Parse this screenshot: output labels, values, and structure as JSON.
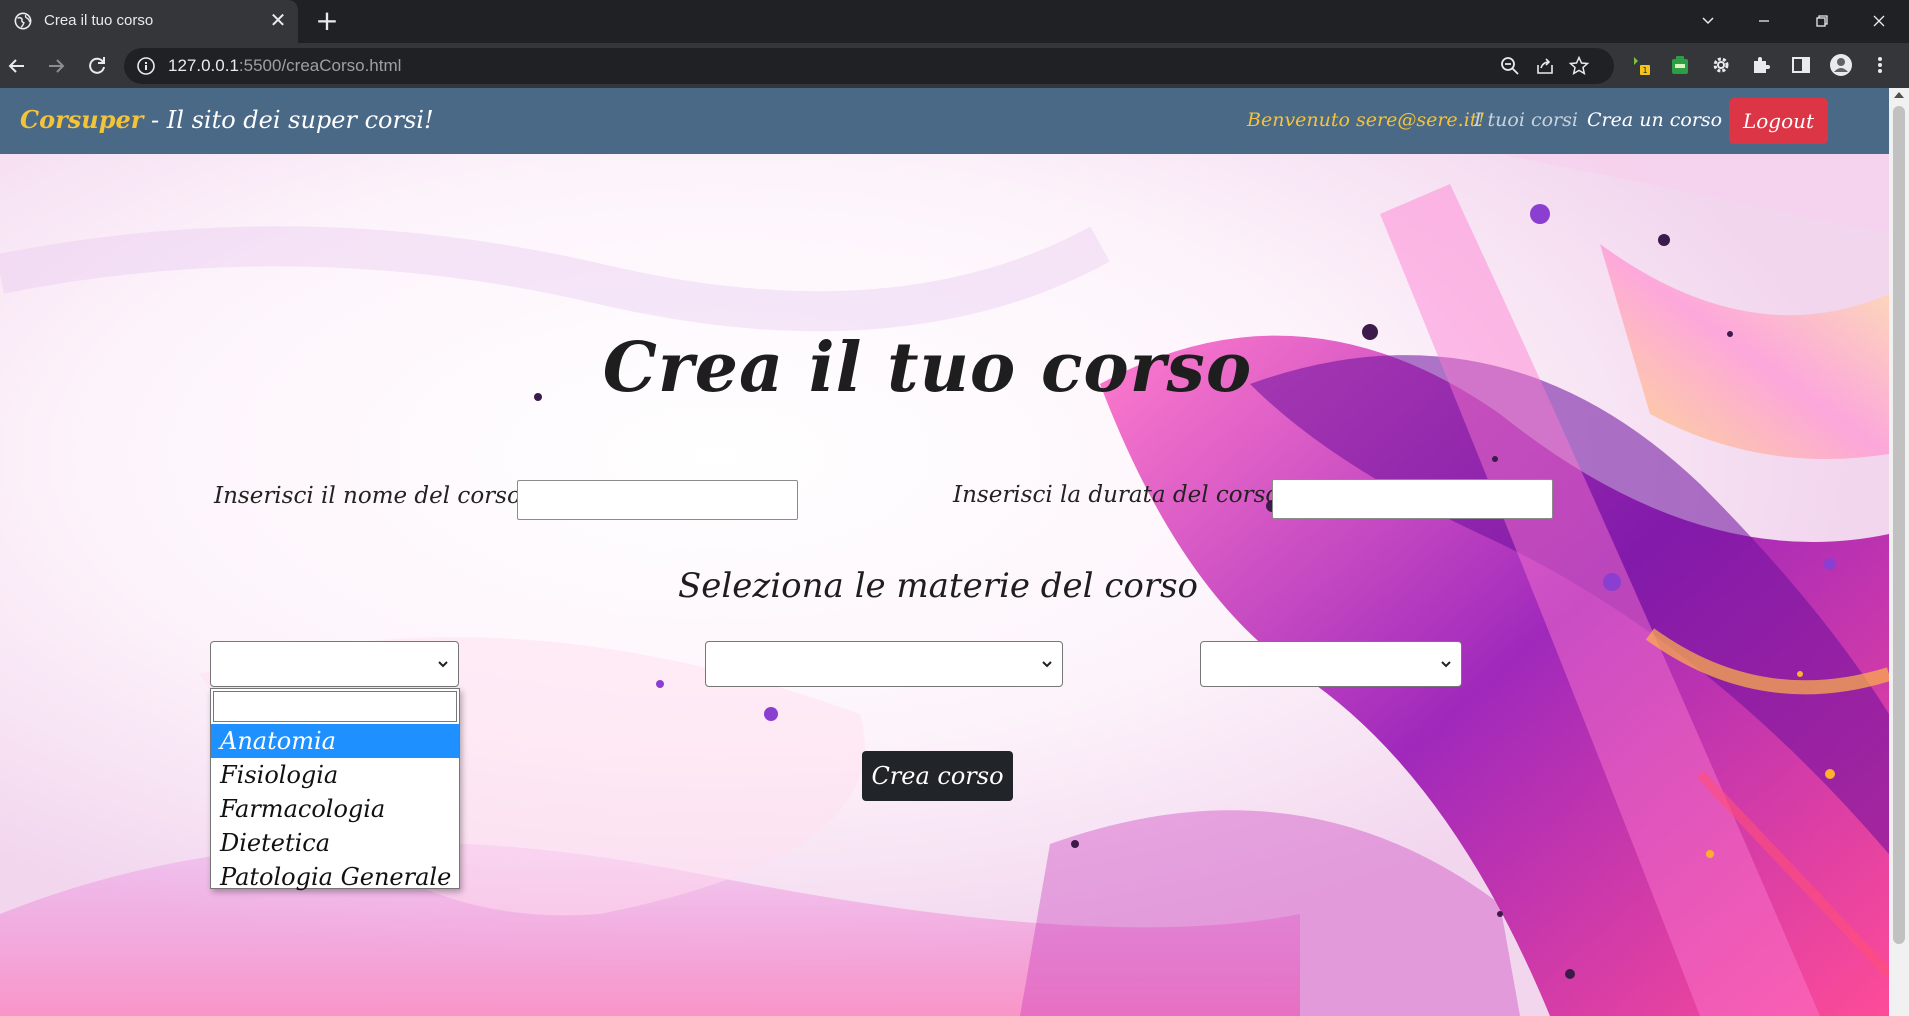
{
  "browser": {
    "tab_title": "Crea il tuo corso",
    "url_host": "127.0.0.1",
    "url_path": ":5500/creaCorso.html",
    "icons": [
      "globe-icon",
      "close-icon",
      "plus-icon",
      "back-icon",
      "forward-icon",
      "reload-icon",
      "info-icon",
      "zoom-icon",
      "share-icon",
      "star-icon",
      "extension-icon",
      "puzzle-icon",
      "sidepanel-icon",
      "profile-icon",
      "menu-icon"
    ]
  },
  "navbar": {
    "brand_name": "Corsuper",
    "brand_tagline": " - Il sito dei super corsi!",
    "welcome": "Benvenuto sere@sere.it!",
    "link_courses": "I tuoi corsi",
    "link_create": "Crea un corso",
    "logout": "Logout",
    "colors": {
      "bar": "#4a6987",
      "brand": "#f3c33a",
      "logout": "#dc3545"
    }
  },
  "form": {
    "title": "Crea il tuo corso",
    "name_label": "Inserisci il nome del corso",
    "name_value": "",
    "duration_label": "Inserisci la durata del corso",
    "duration_value": "",
    "subjects_title": "Seleziona le materie del corso",
    "select_1_value": "",
    "select_2_value": "",
    "select_3_value": "",
    "dropdown_options": [
      "",
      "Anatomia",
      "Fisiologia",
      "Farmacologia",
      "Dietetica",
      "Patologia Generale"
    ],
    "highlighted_option": "Anatomia",
    "submit": "Crea corso"
  }
}
